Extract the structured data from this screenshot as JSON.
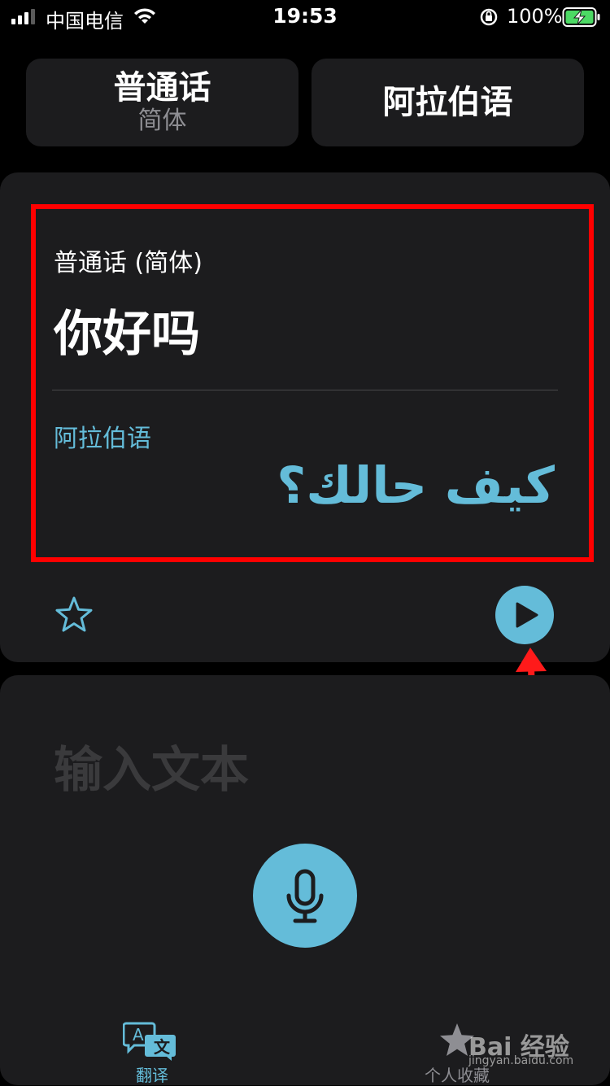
{
  "status_bar": {
    "carrier": "中国电信",
    "time": "19:53",
    "battery_percent": "100%"
  },
  "languages": {
    "source_name": "普通话",
    "source_variant": "简体",
    "target_name": "阿拉伯语"
  },
  "translation": {
    "source_label": "普通话 (简体)",
    "source_text": "你好吗",
    "target_label": "阿拉伯语",
    "target_text": "كيف حالك؟"
  },
  "input": {
    "placeholder": "输入文本"
  },
  "tabs": [
    {
      "label": "翻译",
      "active": true
    },
    {
      "label": "个人收藏",
      "active": false
    }
  ],
  "watermark": {
    "logo": "Bai 经验",
    "url": "jingyan.baidu.com"
  },
  "colors": {
    "accent": "#64bcd9",
    "highlight": "#ff0000",
    "card": "#1c1c1e"
  }
}
